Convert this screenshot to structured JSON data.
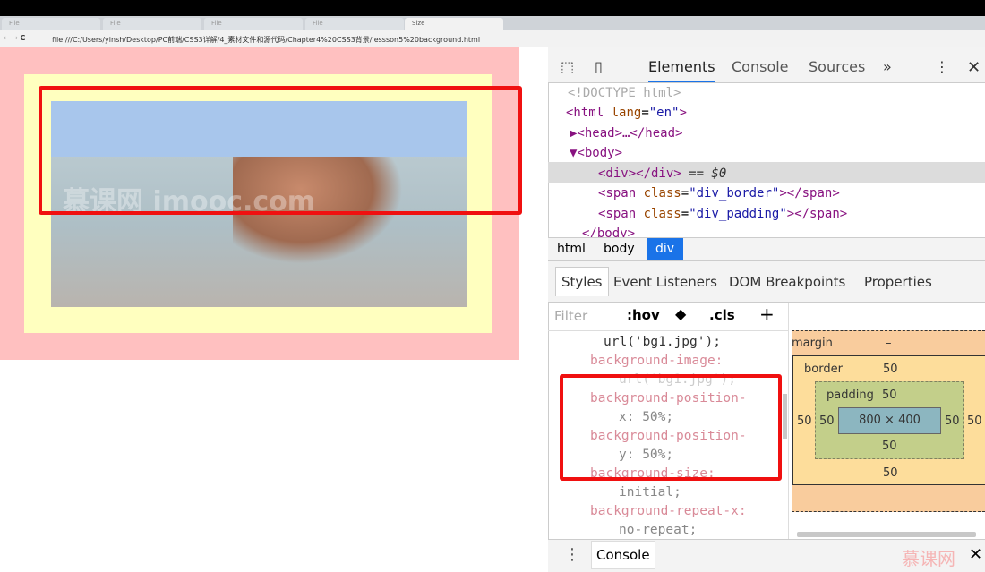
{
  "browser": {
    "tabs": [
      {
        "label": "File"
      },
      {
        "label": "File"
      },
      {
        "label": "File"
      },
      {
        "label": "File"
      },
      {
        "label": "Size",
        "active": true
      }
    ],
    "url": "file:///C:/Users/yinsh/Desktop/PC前端/CSS3详解/4_素材文件和源代码/Chapter4%20CSS3背景/lessson5%20background.html"
  },
  "page": {
    "watermark": "慕课网 imooc.com",
    "colors": {
      "outer": "#ffc0c0",
      "inner": "#ffffbf",
      "highlight": "#f01010"
    }
  },
  "devtools": {
    "tabs": [
      "Elements",
      "Console",
      "Sources",
      "»"
    ],
    "tree": [
      {
        "text": "<!DOCTYPE html>"
      },
      {
        "tag": "<html",
        "attr": "lang",
        "val": "\"en\"",
        "close": ">"
      },
      {
        "text": "▶<head>…</head>"
      },
      {
        "text": "▼<body>"
      },
      {
        "text": "<div></div>",
        "suffix": " == $0"
      },
      {
        "tag": "<span",
        "attr": "class",
        "val": "\"div_border\"",
        "close": "></span>"
      },
      {
        "tag": "<span",
        "attr": "class",
        "val": "\"div_padding\"",
        "close": "></span>"
      },
      {
        "text": "</body>"
      }
    ],
    "breadcrumb": [
      "html",
      "body",
      "div"
    ],
    "style_tabs": [
      "Styles",
      "Event Listeners",
      "DOM Breakpoints",
      "Properties"
    ],
    "filter": {
      "placeholder": "Filter",
      "hov": ":hov",
      "cls": ".cls",
      "add": "+"
    },
    "styles": [
      {
        "value": "url('bg1.jpg');"
      },
      {
        "name": "background-image:"
      },
      {
        "value": "url('bg1.jpg');"
      },
      {
        "name": "background-position-"
      },
      {
        "value": "x: 50%;"
      },
      {
        "name": "background-position-"
      },
      {
        "value": "y: 50%;"
      },
      {
        "name": "background-size:"
      },
      {
        "value": "initial;"
      },
      {
        "name": "background-repeat-x:"
      },
      {
        "value": "no-repeat;"
      }
    ],
    "box_model": {
      "margin_label": "margin",
      "margin": "–",
      "border_label": "border",
      "border": "50",
      "padding_label": "padding",
      "padding": "50",
      "content": "800 × 400"
    },
    "drawer": {
      "console": "Console",
      "logo": "慕课网"
    }
  }
}
